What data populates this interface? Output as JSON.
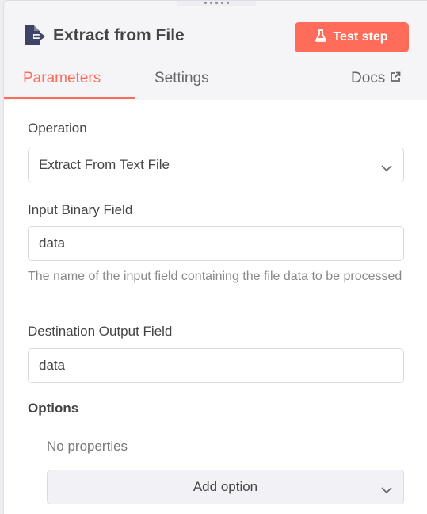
{
  "header": {
    "title": "Extract from File",
    "test_button_label": "Test step"
  },
  "tabs": {
    "parameters": "Parameters",
    "settings": "Settings",
    "docs": "Docs",
    "active": "Parameters"
  },
  "form": {
    "operation": {
      "label": "Operation",
      "value": "Extract From Text File"
    },
    "input_binary_field": {
      "label": "Input Binary Field",
      "value": "data",
      "hint": "The name of the input field containing the file data to be processed"
    },
    "destination_output_field": {
      "label": "Destination Output Field",
      "value": "data"
    },
    "options": {
      "title": "Options",
      "empty_text": "No properties",
      "add_button_label": "Add option"
    }
  },
  "colors": {
    "accent": "#ff6d5a",
    "node_icon": "#3d4466"
  },
  "icons": {
    "node": "file-export-icon",
    "test_button": "flask-icon",
    "docs": "external-link-icon",
    "select": "chevron-down-icon"
  }
}
